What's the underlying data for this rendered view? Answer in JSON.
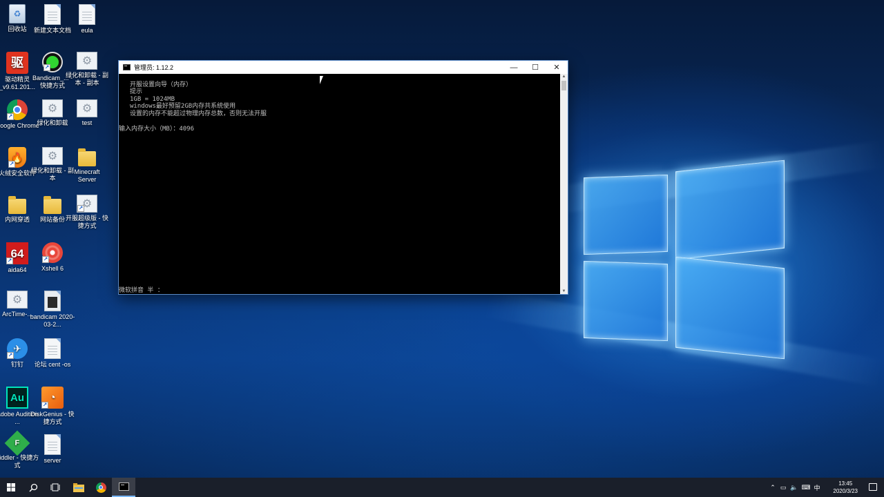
{
  "desktop": {
    "icons": [
      {
        "label": "回收站",
        "kind": "recycle"
      },
      {
        "label": "新建文本文档",
        "kind": "doc"
      },
      {
        "label": "eula",
        "kind": "doc"
      },
      {
        "label": "驱动精灵_v9.61.201...",
        "kind": "app-red",
        "glyph": "驱"
      },
      {
        "label": "Bandicam_... - 快捷方式",
        "kind": "app-green"
      },
      {
        "label": "绿化和卸载 - 副本 - 副本",
        "kind": "gears"
      },
      {
        "label": "Google Chrome",
        "kind": "chrome"
      },
      {
        "label": "绿化和卸载",
        "kind": "gears"
      },
      {
        "label": "test",
        "kind": "gears"
      },
      {
        "label": "火绒安全软件",
        "kind": "shield"
      },
      {
        "label": "绿化和卸载 - 副本",
        "kind": "gears"
      },
      {
        "label": "Minecraft Server",
        "kind": "folder"
      },
      {
        "label": "内网穿透",
        "kind": "folder"
      },
      {
        "label": "网站备份",
        "kind": "folder"
      },
      {
        "label": "开服超级版 - 快捷方式",
        "kind": "gears"
      },
      {
        "label": "aida64",
        "kind": "aida",
        "glyph": "64"
      },
      {
        "label": "Xshell 6",
        "kind": "xshell"
      },
      {
        "label": "ArcTime-...",
        "kind": "gears"
      },
      {
        "label": "bandicam 2020-03-2...",
        "kind": "doc"
      },
      {
        "label": "钉钉",
        "kind": "ding"
      },
      {
        "label": "论坛 cent -os",
        "kind": "doc"
      },
      {
        "label": "Adobe Audition ...",
        "kind": "au",
        "glyph": "Au"
      },
      {
        "label": "DiskGenius - 快捷方式",
        "kind": "disk"
      },
      {
        "label": "Fiddler - 快捷方式",
        "kind": "fiddler",
        "glyph": "F"
      },
      {
        "label": "server",
        "kind": "doc"
      }
    ]
  },
  "console": {
    "title": "管理员: 1.12.2",
    "lines": [
      "开服设置向导（内存）",
      "提示",
      "1GB = 1024MB",
      "windows最好预留2GB内存共系统使用",
      "设置的内存不能超过物理内存总数，否则无法开服",
      "",
      "输入内存大小（MB）：4096"
    ],
    "ime_status": "微软拼音 半 ：",
    "buttons": {
      "minimize": "—",
      "maximize": "☐",
      "close": "✕"
    }
  },
  "taskbar": {
    "clock_time": "13:45",
    "clock_date": "2020/3/23",
    "ime_indicator": "中"
  },
  "colors": {
    "console_text": "#c0c0c0",
    "taskbar_bg": "#1a1f2a",
    "accent": "#7ab8ff"
  }
}
